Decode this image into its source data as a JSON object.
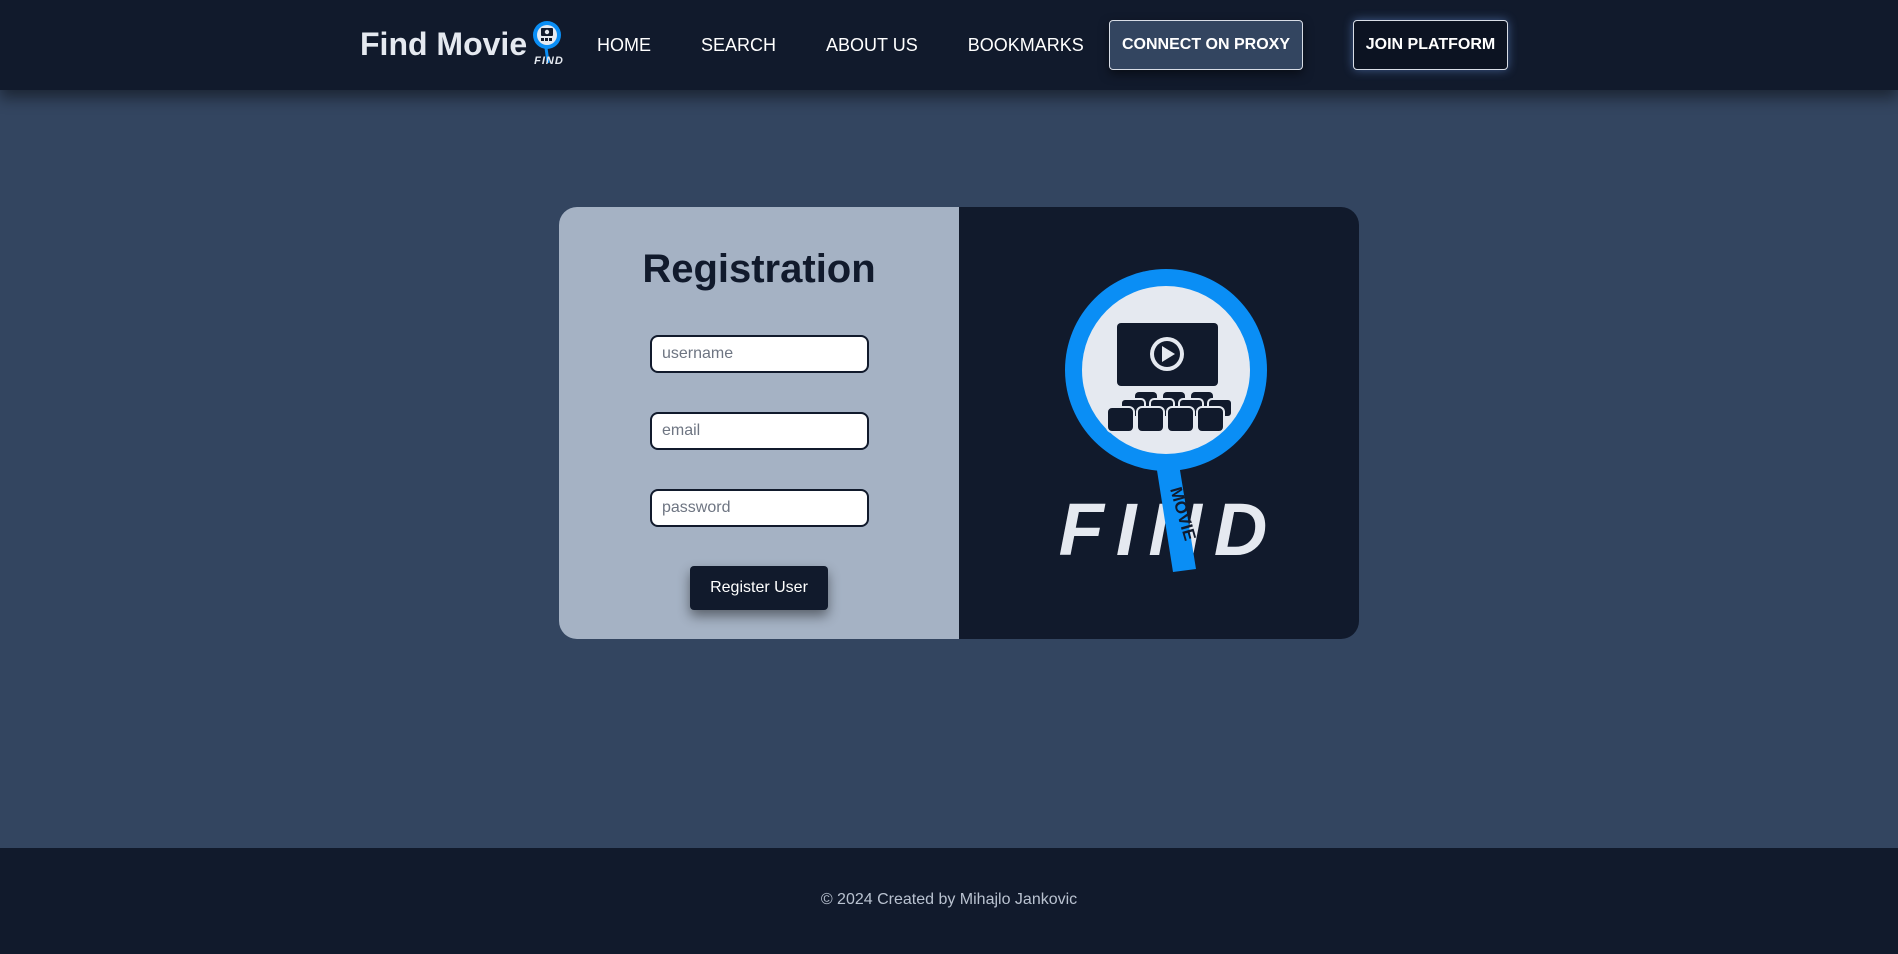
{
  "header": {
    "brand_title": "Find Movie",
    "logo_text": "FIND",
    "nav": [
      {
        "label": "HOME"
      },
      {
        "label": "SEARCH"
      },
      {
        "label": "ABOUT US"
      },
      {
        "label": "BOOKMARKS"
      }
    ],
    "proxy_button": "CONNECT ON PROXY",
    "join_button": "JOIN PLATFORM"
  },
  "registration": {
    "title": "Registration",
    "username_placeholder": "username",
    "email_placeholder": "email",
    "password_placeholder": "password",
    "submit_label": "Register User"
  },
  "hero_logo": {
    "word": "FIND",
    "handle_text": "MOVIE"
  },
  "footer": {
    "text": "© 2024 Created by Mihajlo Jankovic"
  },
  "colors": {
    "page_bg": "#334560",
    "navy": "#111a2c",
    "card_left_bg": "#a5b2c4",
    "accent_blue": "#0a8ef5",
    "light": "#e5e9f0"
  }
}
